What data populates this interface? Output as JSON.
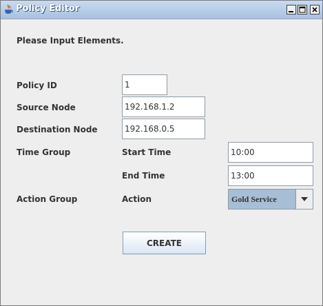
{
  "window": {
    "title": "Policy Editor",
    "icon": "java-cup-icon",
    "controls": {
      "minimize": "minimize-icon",
      "maximize": "maximize-icon",
      "close": "close-icon"
    }
  },
  "form": {
    "instruction": "Please Input Elements.",
    "policy_id": {
      "label": "Policy ID",
      "value": "1"
    },
    "source_node": {
      "label": "Source Node",
      "value": "192.168.1.2"
    },
    "destination_node": {
      "label": "Destination Node",
      "value": "192.168.0.5"
    },
    "time_group": {
      "label": "Time Group",
      "start_time": {
        "label": "Start Time",
        "value": "10:00"
      },
      "end_time": {
        "label": "End Time",
        "value": "13:00"
      }
    },
    "action_group": {
      "label": "Action Group",
      "action": {
        "label": "Action",
        "selected": "Gold Service"
      }
    },
    "create_button": "CREATE"
  },
  "colors": {
    "titlebar": "#a9c1df",
    "window_bg": "#eeeeee",
    "combo_selected_bg": "#a8bdd6"
  }
}
